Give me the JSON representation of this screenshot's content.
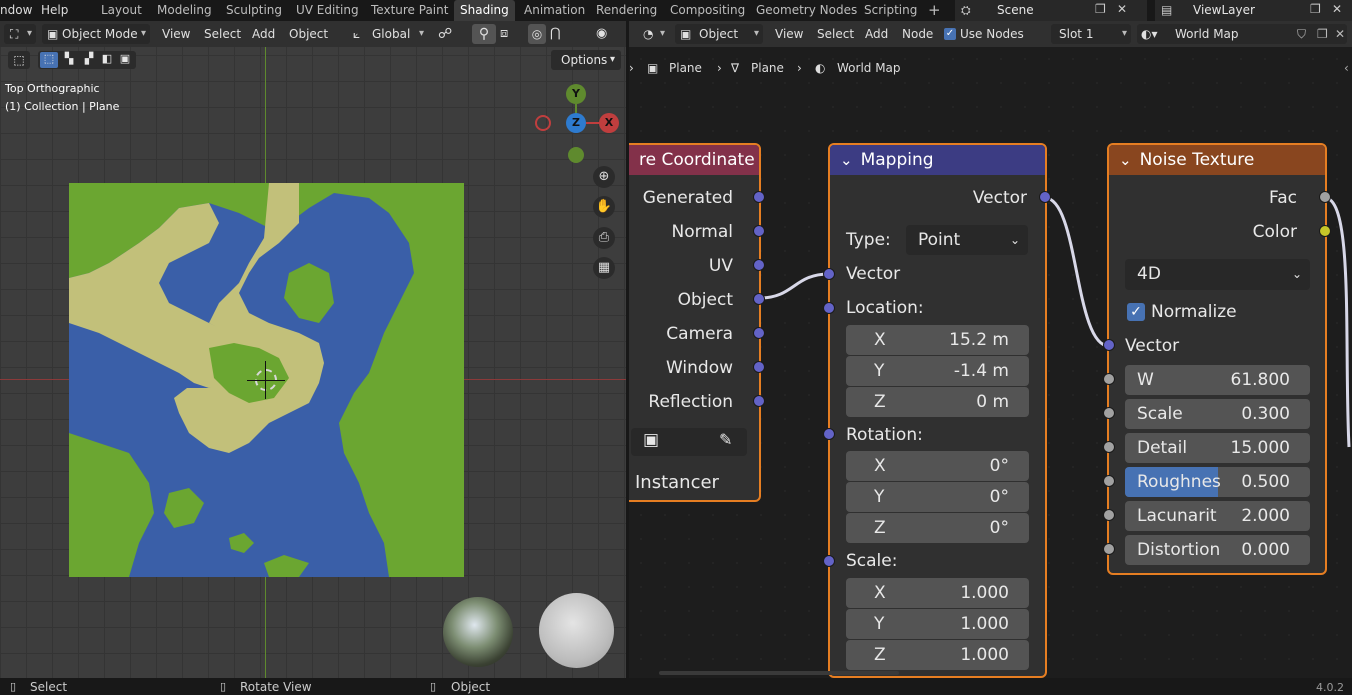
{
  "topbar": {
    "menus": [
      "ndow",
      "Help"
    ],
    "workspaces": [
      "Layout",
      "Modeling",
      "Sculpting",
      "UV Editing",
      "Texture Paint",
      "Shading",
      "Animation",
      "Rendering",
      "Compositing",
      "Geometry Nodes",
      "Scripting"
    ],
    "active_workspace": "Shading",
    "scene": "Scene",
    "view_layer": "ViewLayer"
  },
  "viewport_header": {
    "mode": "Object Mode",
    "menus": [
      "View",
      "Select",
      "Add",
      "Object"
    ],
    "transform": "Global",
    "options": "Options"
  },
  "viewport": {
    "view_name": "Top Orthographic",
    "collection": "(1) Collection | Plane",
    "gizmo": {
      "y": "Y",
      "z": "Z",
      "x": "X"
    }
  },
  "node_header": {
    "type": "Object",
    "menus": [
      "View",
      "Select",
      "Add",
      "Node"
    ],
    "use_nodes": "Use Nodes",
    "slot": "Slot 1",
    "material": "World Map"
  },
  "breadcrumb": [
    "Plane",
    "Plane",
    "World Map"
  ],
  "texcoord_node": {
    "title": "re Coordinate",
    "outputs": [
      "Generated",
      "Normal",
      "UV",
      "Object",
      "Camera",
      "Window",
      "Reflection"
    ],
    "instancer": "Instancer"
  },
  "mapping_node": {
    "title": "Mapping",
    "output": "Vector",
    "type_label": "Type:",
    "type_value": "Point",
    "vector_label": "Vector",
    "location_label": "Location:",
    "location": [
      {
        "axis": "X",
        "value": "15.2 m"
      },
      {
        "axis": "Y",
        "value": "-1.4 m"
      },
      {
        "axis": "Z",
        "value": "0 m"
      }
    ],
    "rotation_label": "Rotation:",
    "rotation": [
      {
        "axis": "X",
        "value": "0°"
      },
      {
        "axis": "Y",
        "value": "0°"
      },
      {
        "axis": "Z",
        "value": "0°"
      }
    ],
    "scale_label": "Scale:",
    "scale": [
      {
        "axis": "X",
        "value": "1.000"
      },
      {
        "axis": "Y",
        "value": "1.000"
      },
      {
        "axis": "Z",
        "value": "1.000"
      }
    ]
  },
  "noise_node": {
    "title": "Noise Texture",
    "outputs": [
      "Fac",
      "Color"
    ],
    "dimensions": "4D",
    "normalize": "Normalize",
    "vector_label": "Vector",
    "inputs": [
      {
        "label": "W",
        "value": "61.800"
      },
      {
        "label": "Scale",
        "value": "0.300"
      },
      {
        "label": "Detail",
        "value": "15.000"
      },
      {
        "label": "Roughnes",
        "value": "0.500"
      },
      {
        "label": "Lacunarit",
        "value": "2.000"
      },
      {
        "label": "Distortion",
        "value": "0.000"
      }
    ],
    "roughness_fill": 0.5
  },
  "statusbar": {
    "select": "Select",
    "rotate": "Rotate View",
    "object": "Object",
    "version": "4.0.2"
  },
  "colors": {
    "mapping_header": "#3c3c83",
    "noise_header": "#89461f",
    "texcoord_header": "#83314a",
    "ocean": "#3a5fa8",
    "land_green": "#6ba631",
    "land_sand": "#c2c07a",
    "active_highlight": "#4772b3"
  }
}
